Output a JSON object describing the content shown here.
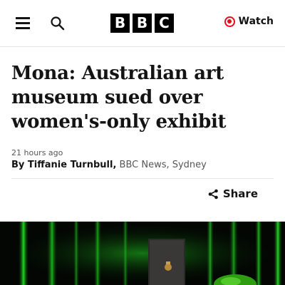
{
  "header": {
    "logo_letters": [
      "B",
      "B",
      "C"
    ],
    "watch_label": "Watch",
    "accent_color": "#e0101e"
  },
  "article": {
    "headline": "Mona: Australian art museum sued over women's-only exhibit",
    "timestamp": "21 hours ago",
    "byline_prefix": "By ",
    "author": "Tiffanie Turnbull",
    "author_suffix": ",",
    "outlet": " BBC News, Sydney",
    "share_label": "Share"
  },
  "icons": {
    "menu": "hamburger-menu-icon",
    "search": "search-icon",
    "watch": "live-record-icon",
    "share": "share-icon"
  }
}
